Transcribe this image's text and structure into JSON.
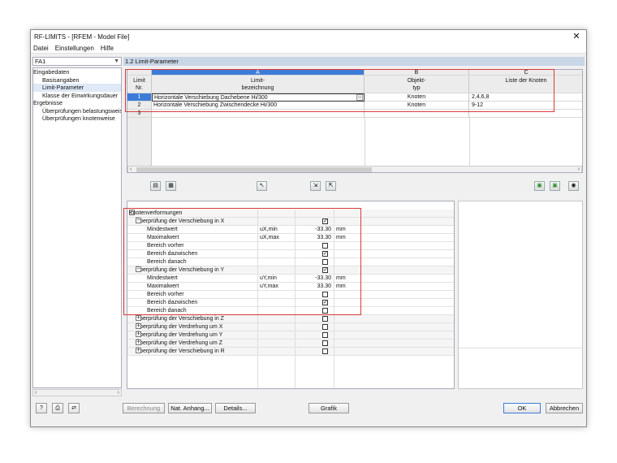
{
  "window": {
    "title": "RF-LIMITS - [RFEM - Model File]",
    "close": "✕"
  },
  "menu": [
    "Datei",
    "Einstellungen",
    "Hilfe"
  ],
  "case_select": {
    "value": "FA1"
  },
  "tree": {
    "groups": [
      {
        "label": "Eingabedaten",
        "children": [
          "Basisangaben",
          "Limit-Parameter",
          "Klasse der Einwirkungsdauer"
        ]
      },
      {
        "label": "Ergebnisse",
        "children": [
          "Überprüfungen belastungsweise",
          "Überprüfungen knotenweise"
        ]
      }
    ],
    "selected": "Limit-Parameter"
  },
  "panel": {
    "title": "1.2 Limit-Parameter"
  },
  "table": {
    "col_letters": [
      "A",
      "B",
      "C"
    ],
    "headers": {
      "limit_nr": [
        "Limit",
        "Nr."
      ],
      "bezeichnung": [
        "Limit-",
        "bezeichnung"
      ],
      "typ": [
        "Objekt-",
        "typ"
      ],
      "knoten": [
        "",
        "Liste der Knoten"
      ]
    },
    "rows": [
      {
        "nr": "1",
        "name": "Horizontale Verschiebung Dachebene Hi/300",
        "typ": "Knoten",
        "knoten": "2,4,6,8"
      },
      {
        "nr": "2",
        "name": "Horizontale Verschiebung Zwischendecke Hi/300",
        "typ": "Knoten",
        "knoten": "9-12"
      },
      {
        "nr": "3",
        "name": "",
        "typ": "",
        "knoten": ""
      }
    ]
  },
  "details": {
    "root": "Knotenverformungen",
    "rows": [
      {
        "label": "Überprüfung der Verschiebung in X",
        "level": 1,
        "expand": "−",
        "sym": "",
        "value": "",
        "unit": "",
        "check": true,
        "group": true
      },
      {
        "label": "Mindestwert",
        "level": 2,
        "sym": "uX,min",
        "value": "-33.30",
        "unit": "mm",
        "check": null
      },
      {
        "label": "Maximalwert",
        "level": 2,
        "sym": "uX,max",
        "value": "33.30",
        "unit": "mm",
        "check": null
      },
      {
        "label": "Bereich vorher",
        "level": 2,
        "sym": "",
        "value": "",
        "unit": "",
        "check": false
      },
      {
        "label": "Bereich dazwischen",
        "level": 2,
        "sym": "",
        "value": "",
        "unit": "",
        "check": true
      },
      {
        "label": "Bereich danach",
        "level": 2,
        "sym": "",
        "value": "",
        "unit": "",
        "check": false
      },
      {
        "label": "Überprüfung der Verschiebung in Y",
        "level": 1,
        "expand": "−",
        "sym": "",
        "value": "",
        "unit": "",
        "check": true,
        "group": true
      },
      {
        "label": "Mindestwert",
        "level": 2,
        "sym": "uY,min",
        "value": "-33.30",
        "unit": "mm",
        "check": null
      },
      {
        "label": "Maximalwert",
        "level": 2,
        "sym": "uY,max",
        "value": "33.30",
        "unit": "mm",
        "check": null
      },
      {
        "label": "Bereich vorher",
        "level": 2,
        "sym": "",
        "value": "",
        "unit": "",
        "check": false
      },
      {
        "label": "Bereich dazwischen",
        "level": 2,
        "sym": "",
        "value": "",
        "unit": "",
        "check": true
      },
      {
        "label": "Bereich danach",
        "level": 2,
        "sym": "",
        "value": "",
        "unit": "",
        "check": false
      },
      {
        "label": "Überprüfung der Verschiebung in Z",
        "level": 1,
        "expand": "+",
        "sym": "",
        "value": "",
        "unit": "",
        "check": false,
        "group": true
      },
      {
        "label": "Überprüfung der Verdrehung um X",
        "level": 1,
        "expand": "+",
        "sym": "",
        "value": "",
        "unit": "",
        "check": false,
        "group": true
      },
      {
        "label": "Überprüfung der Verdrehung um Y",
        "level": 1,
        "expand": "+",
        "sym": "",
        "value": "",
        "unit": "",
        "check": false,
        "group": true
      },
      {
        "label": "Überprüfung der Verdrehung um Z",
        "level": 1,
        "expand": "+",
        "sym": "",
        "value": "",
        "unit": "",
        "check": false,
        "group": true
      },
      {
        "label": "Überprüfung der Verschiebung in R",
        "level": 1,
        "expand": "+",
        "sym": "",
        "value": "",
        "unit": "",
        "check": false,
        "group": true
      }
    ]
  },
  "buttons": {
    "berechnung": "Berechnung",
    "nat_anhang": "Nat. Anhang...",
    "details": "Details...",
    "grafik": "Grafik",
    "ok": "OK",
    "abbrechen": "Abbrechen"
  }
}
